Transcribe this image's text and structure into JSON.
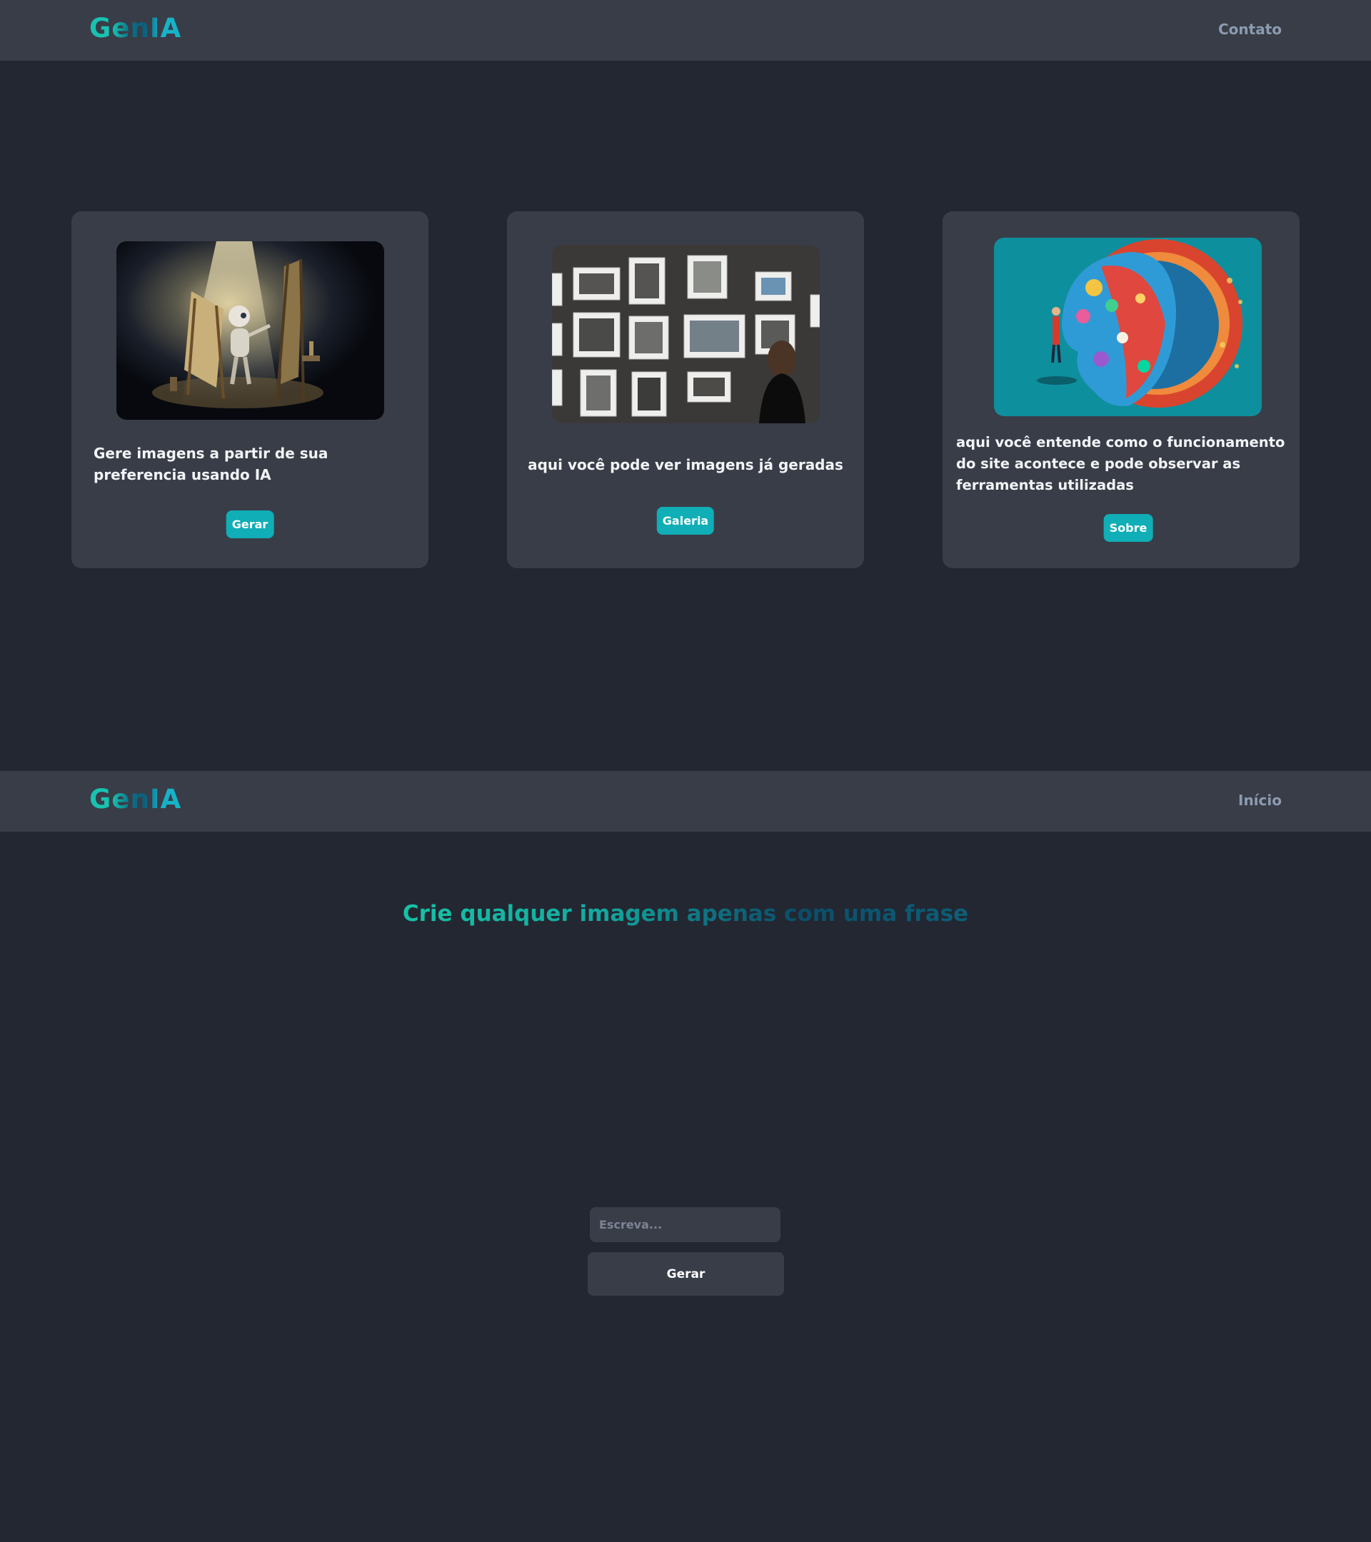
{
  "brand": {
    "logo": "GenIA",
    "accent": "#10aeb6",
    "background": "#222732",
    "surface": "#393d48"
  },
  "nav_top": {
    "link": "Contato"
  },
  "cards": [
    {
      "image": "robot-painting-image",
      "text": "Gere imagens a partir de sua preferencia usando IA",
      "button": "Gerar"
    },
    {
      "image": "gallery-wall-image",
      "text": "aqui você pode ver imagens já geradas",
      "button": "Galeria"
    },
    {
      "image": "colorful-head-image",
      "text": "aqui você entende como o funcionamento do site acontece e pode observar as ferramentas utilizadas",
      "button": "Sobre"
    }
  ],
  "nav_second": {
    "link": "Início"
  },
  "generator": {
    "headline": "Crie qualquer imagem apenas com uma frase",
    "input_placeholder": "Escreva...",
    "input_value": "",
    "button": "Gerar"
  }
}
